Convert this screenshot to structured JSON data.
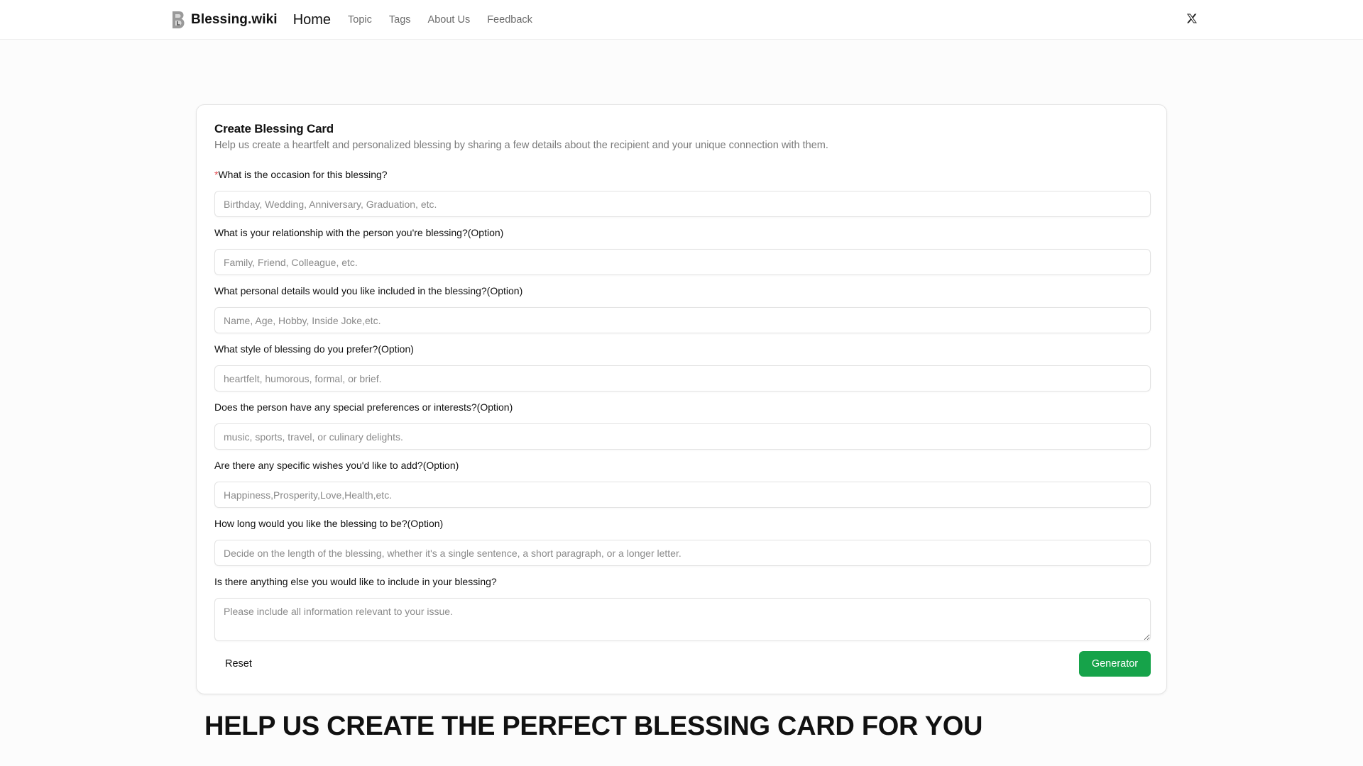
{
  "header": {
    "logo_text": "Blessing.wiki",
    "logo_icon": "b-logo-icon",
    "nav": {
      "home": "Home",
      "topic": "Topic",
      "tags": "Tags",
      "about": "About Us",
      "feedback": "Feedback"
    },
    "social_icon": "x-twitter-icon"
  },
  "card": {
    "title": "Create Blessing Card",
    "description": "Help us create a heartfelt and personalized blessing by sharing a few details about the recipient and your unique connection with them.",
    "fields": [
      {
        "required_mark": "*",
        "label": "What is the occasion for this blessing?",
        "placeholder": "Birthday, Wedding, Anniversary, Graduation, etc.",
        "value": ""
      },
      {
        "label": "What is your relationship with the person you're blessing?(Option)",
        "placeholder": "Family, Friend, Colleague, etc.",
        "value": ""
      },
      {
        "label": "What personal details would you like included in the blessing?(Option)",
        "placeholder": "Name, Age, Hobby, Inside Joke,etc.",
        "value": ""
      },
      {
        "label": "What style of blessing do you prefer?(Option)",
        "placeholder": "heartfelt, humorous, formal, or brief.",
        "value": ""
      },
      {
        "label": "Does the person have any special preferences or interests?(Option)",
        "placeholder": "music, sports, travel, or culinary delights.",
        "value": ""
      },
      {
        "label": "Are there any specific wishes you'd like to add?(Option)",
        "placeholder": "Happiness,Prosperity,Love,Health,etc.",
        "value": ""
      },
      {
        "label": "How long would you like the blessing to be?(Option)",
        "placeholder": "Decide on the length of the blessing, whether it's a single sentence, a short paragraph, or a longer letter.",
        "value": ""
      },
      {
        "label": "Is there anything else you would like to include in your blessing?",
        "placeholder": "Please include all information relevant to your issue.",
        "value": ""
      }
    ],
    "reset_label": "Reset",
    "generate_label": "Generator"
  },
  "section": {
    "heading": "HELP US CREATE THE PERFECT BLESSING CARD FOR YOU"
  },
  "colors": {
    "primary_button": "#16a34a",
    "required_mark": "#e5484d"
  }
}
